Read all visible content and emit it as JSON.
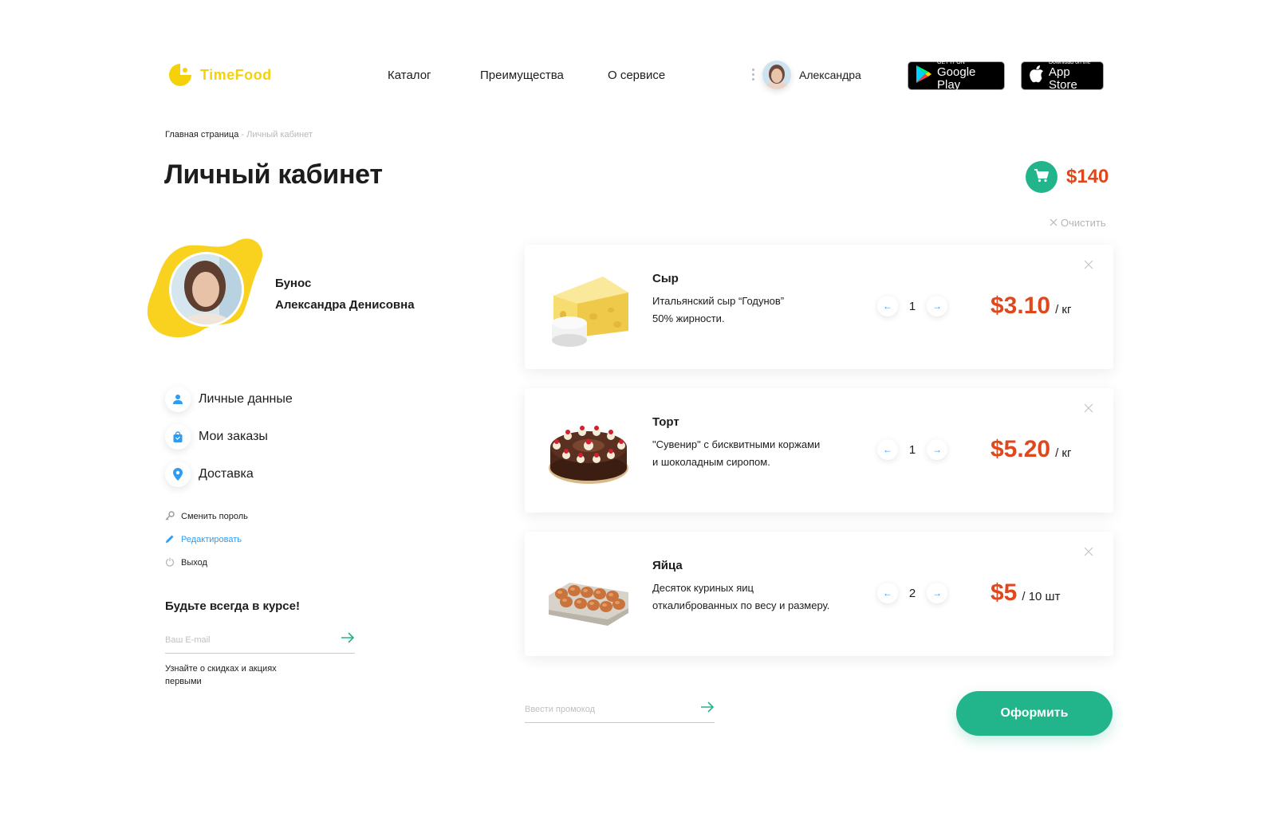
{
  "header": {
    "logo_text": "TimeFood",
    "nav": [
      "Каталог",
      "Преимущества",
      "О сервисе"
    ],
    "user_name": "Александра",
    "google_play": {
      "small": "GET IT ON",
      "big": "Google Play"
    },
    "app_store": {
      "small": "Download on the",
      "big": "App Store"
    }
  },
  "breadcrumb": {
    "home": "Главная страница",
    "separator": "-",
    "current": "Личный кабинет"
  },
  "page_title": "Личный кабинет",
  "cart": {
    "total": "$140",
    "clear_label": "Очистить"
  },
  "profile": {
    "last_name": "Бунос",
    "first_middle": "Александра Денисовна"
  },
  "menu": [
    {
      "label": "Личные данные",
      "icon": "person-icon"
    },
    {
      "label": "Мои заказы",
      "icon": "bag-icon"
    },
    {
      "label": "Доставка",
      "icon": "location-pin-icon"
    }
  ],
  "links": [
    {
      "label": "Сменить пороль",
      "icon": "key-icon"
    },
    {
      "label": "Редактировать",
      "icon": "pencil-icon"
    },
    {
      "label": "Выход",
      "icon": "power-icon"
    }
  ],
  "newsletter": {
    "title": "Будьте всегда в курсе!",
    "placeholder": "Ваш E-mail",
    "note": "Узнайте о скидках и акциях первыми"
  },
  "items": [
    {
      "name": "Сыр",
      "desc_1": "Итальянский сыр “Годунов”",
      "desc_2": "50% жирности.",
      "qty": "1",
      "price": "$3.10",
      "unit": "/ кг",
      "image": "cheese"
    },
    {
      "name": "Торт",
      "desc_1": "\"Сувенир\" с бисквитными коржами",
      "desc_2": "и шоколадным сиропом.",
      "qty": "1",
      "price": "$5.20",
      "unit": "/ кг",
      "image": "cake"
    },
    {
      "name": "Яйца",
      "desc_1": "Десяток куриных яиц",
      "desc_2": "откалиброванных по весу и размеру.",
      "qty": "2",
      "price": "$5",
      "unit": "/ 10 шт",
      "image": "eggs"
    }
  ],
  "promo": {
    "placeholder": "Ввести промокод"
  },
  "checkout_label": "Оформить",
  "colors": {
    "accent_green": "#22b48a",
    "price_red": "#e0471d",
    "brand_yellow": "#f5d10a",
    "link_blue": "#2f9cf2"
  }
}
